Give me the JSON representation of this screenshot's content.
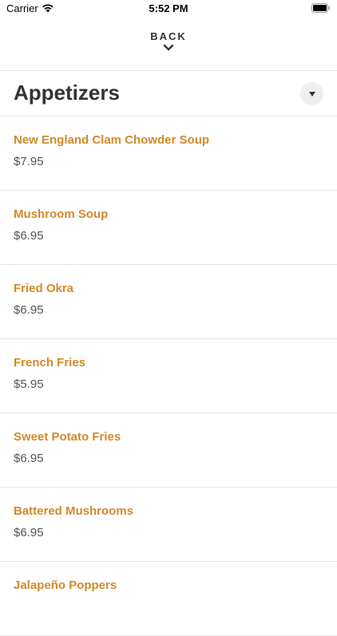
{
  "status_bar": {
    "carrier": "Carrier",
    "time": "5:52 PM"
  },
  "header": {
    "back_label": "BACK"
  },
  "section": {
    "title": "Appetizers"
  },
  "menu_items": [
    {
      "name": "New England Clam Chowder Soup",
      "price": "$7.95"
    },
    {
      "name": "Mushroom Soup",
      "price": "$6.95"
    },
    {
      "name": "Fried Okra",
      "price": "$6.95"
    },
    {
      "name": "French Fries",
      "price": "$5.95"
    },
    {
      "name": "Sweet Potato Fries",
      "price": "$6.95"
    },
    {
      "name": "Battered Mushrooms",
      "price": "$6.95"
    },
    {
      "name": "Jalapeño Poppers",
      "price": ""
    }
  ],
  "colors": {
    "accent": "#d2892a",
    "text": "#333333",
    "divider": "#e6e6e6"
  },
  "icons": {
    "wifi": "wifi-icon",
    "battery": "battery-icon",
    "back_chevron": "chevron-down-icon",
    "dropdown_caret": "caret-down-icon"
  }
}
